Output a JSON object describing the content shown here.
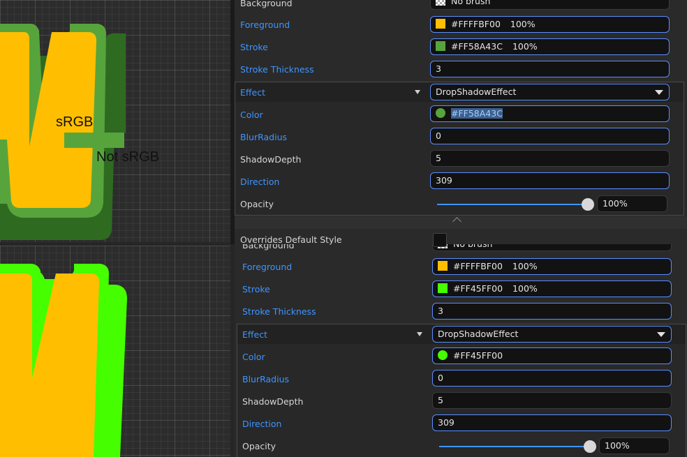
{
  "canvas_top": {
    "annotation_srgb": "sRGB",
    "annotation_not_srgb": "Not sRGB"
  },
  "panel_top": {
    "rows": {
      "background": {
        "label": "Background",
        "value": "No brush"
      },
      "foreground": {
        "label": "Foreground",
        "value": "#FFFFBF00",
        "percent": "100%"
      },
      "stroke": {
        "label": "Stroke",
        "value": "#FF58A43C",
        "percent": "100%"
      },
      "stroke_thickness": {
        "label": "Stroke Thickness",
        "value": "3"
      },
      "effect": {
        "label": "Effect",
        "value": "DropShadowEffect"
      },
      "color": {
        "label": "Color",
        "value": "#FF58A43C"
      },
      "blur_radius": {
        "label": "BlurRadius",
        "value": "0"
      },
      "shadow_depth": {
        "label": "ShadowDepth",
        "value": "5"
      },
      "direction": {
        "label": "Direction",
        "value": "309"
      },
      "opacity": {
        "label": "Opacity",
        "value": "100%",
        "level": 1.0
      }
    }
  },
  "panel_bottom": {
    "overrides_label": "Overrides Default Style",
    "rows": {
      "background": {
        "label": "Background",
        "value": "No brush"
      },
      "foreground": {
        "label": "Foreground",
        "value": "#FFFFBF00",
        "percent": "100%"
      },
      "stroke": {
        "label": "Stroke",
        "value": "#FF45FF00",
        "percent": "100%"
      },
      "stroke_thickness": {
        "label": "Stroke Thickness",
        "value": "3"
      },
      "effect": {
        "label": "Effect",
        "value": "DropShadowEffect"
      },
      "color": {
        "label": "Color",
        "value": "#FF45FF00"
      },
      "blur_radius": {
        "label": "BlurRadius",
        "value": "0"
      },
      "shadow_depth": {
        "label": "ShadowDepth",
        "value": "5"
      },
      "direction": {
        "label": "Direction",
        "value": "309"
      },
      "opacity": {
        "label": "Opacity",
        "value": "100%",
        "level": 1.0
      }
    }
  },
  "colors": {
    "foreground": "#FFBF00",
    "stroke_top": "#58A43C",
    "stroke_bottom": "#45FF00",
    "accent": "#3f95ff"
  },
  "icons": [
    "checkerboard-icon",
    "chevron-down-icon",
    "expand-triangle-icon",
    "collapse-up-icon",
    "checkbox-icon"
  ]
}
